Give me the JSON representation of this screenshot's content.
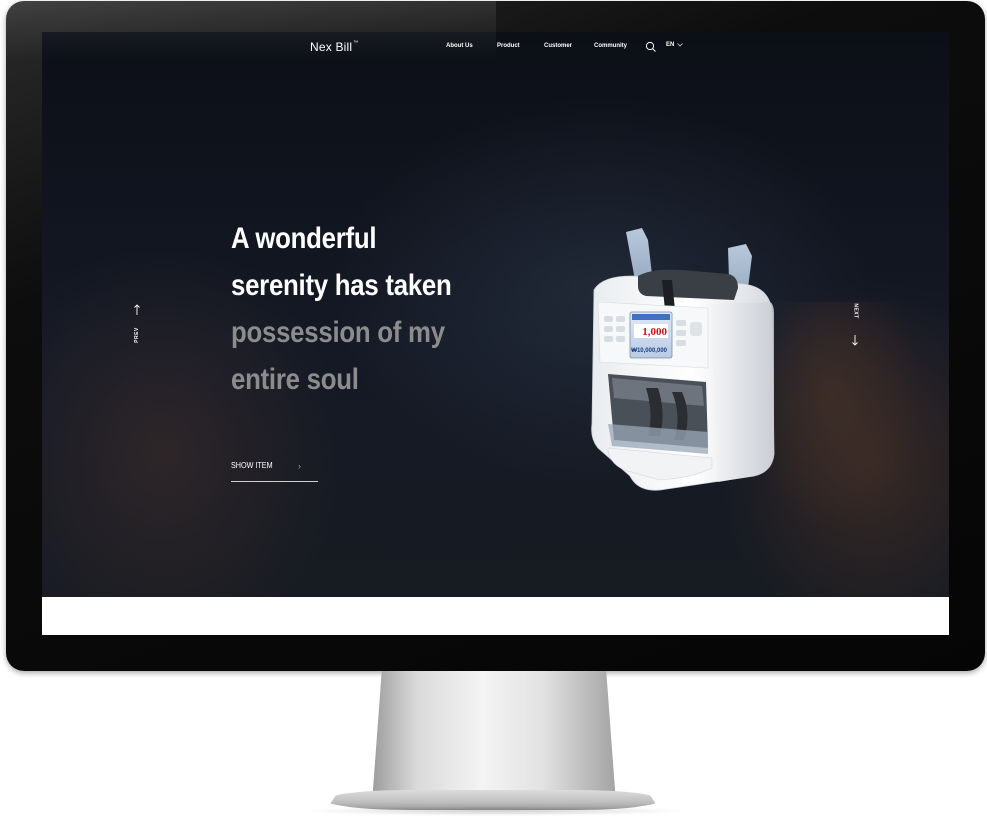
{
  "nav": {
    "logo": "Nex Bill",
    "logo_tm": "™",
    "links": [
      "About Us",
      "Product",
      "Customer",
      "Community"
    ],
    "language": "EN",
    "search_icon": "search-icon",
    "language_icon": "chevron-down-icon"
  },
  "hero": {
    "headline_bright": [
      "A wonderful",
      "serenity has taken"
    ],
    "headline_dim": [
      "possession of my",
      "entire soul"
    ],
    "cta_label": "SHOW ITEM",
    "cta_icon": "chevron-right-icon",
    "prev_label": "PREV",
    "next_label": "NEXT",
    "prev_icon": "arrow-up-icon",
    "next_icon": "arrow-down-icon"
  },
  "product": {
    "display_count": "1,000",
    "display_amount": "₩10,000,000"
  },
  "colors": {
    "hero_background": "#0b0d12",
    "headline_primary": "#ffffff",
    "headline_secondary": "#8c8c8c",
    "accent_red": "#d0141d"
  }
}
